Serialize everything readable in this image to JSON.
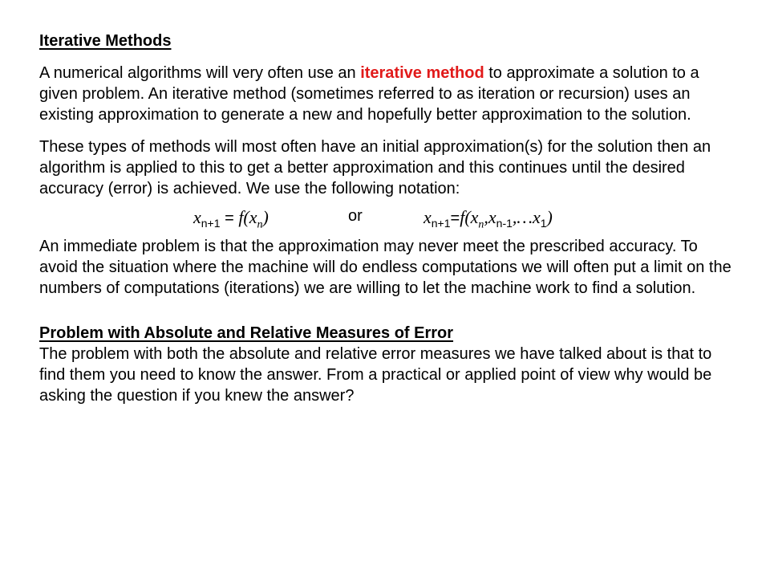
{
  "section1": {
    "heading": "Iterative Methods",
    "para1_before": "A numerical algorithms will very often use an ",
    "para1_highlight": "iterative method",
    "para1_after": " to approximate a solution to a given problem. An iterative method (sometimes referred to as iteration or recursion) uses an existing approximation to generate a new and hopefully better approximation to the solution.",
    "para2": "These types of methods will most often have an initial approximation(s) for the solution then an algorithm is applied to this to get a better approximation and this continues until the desired accuracy (error) is achieved. We use the following notation:",
    "formula": {
      "left": {
        "var": "x",
        "sub": "n+1",
        "eq": " = ",
        "func": "f(x",
        "arg_sub": "n",
        "close": ")"
      },
      "separator": "or",
      "right": {
        "var": "x",
        "sub": "n+1",
        "eq": "=",
        "func": "f(x",
        "arg1_sub": "n",
        "comma1": ",x",
        "arg2_sub": "n-1",
        "rest": ",…x",
        "arg3_sub": "1",
        "close": ")"
      }
    },
    "para3": "An immediate problem is that the approximation may never meet the prescribed accuracy. To avoid the situation where the machine will do endless computations we will often put a limit on the numbers of computations (iterations) we are willing to let the machine work to find a solution."
  },
  "section2": {
    "heading": "Problem with Absolute and Relative Measures of Error",
    "para": "The problem with both the absolute and relative error measures we have talked about is that to find them you need to know the answer. From a practical or applied point of view why would be asking the question if you knew the answer?"
  },
  "colors": {
    "highlight": "#e11a1a",
    "text": "#000000",
    "background": "#ffffff"
  }
}
